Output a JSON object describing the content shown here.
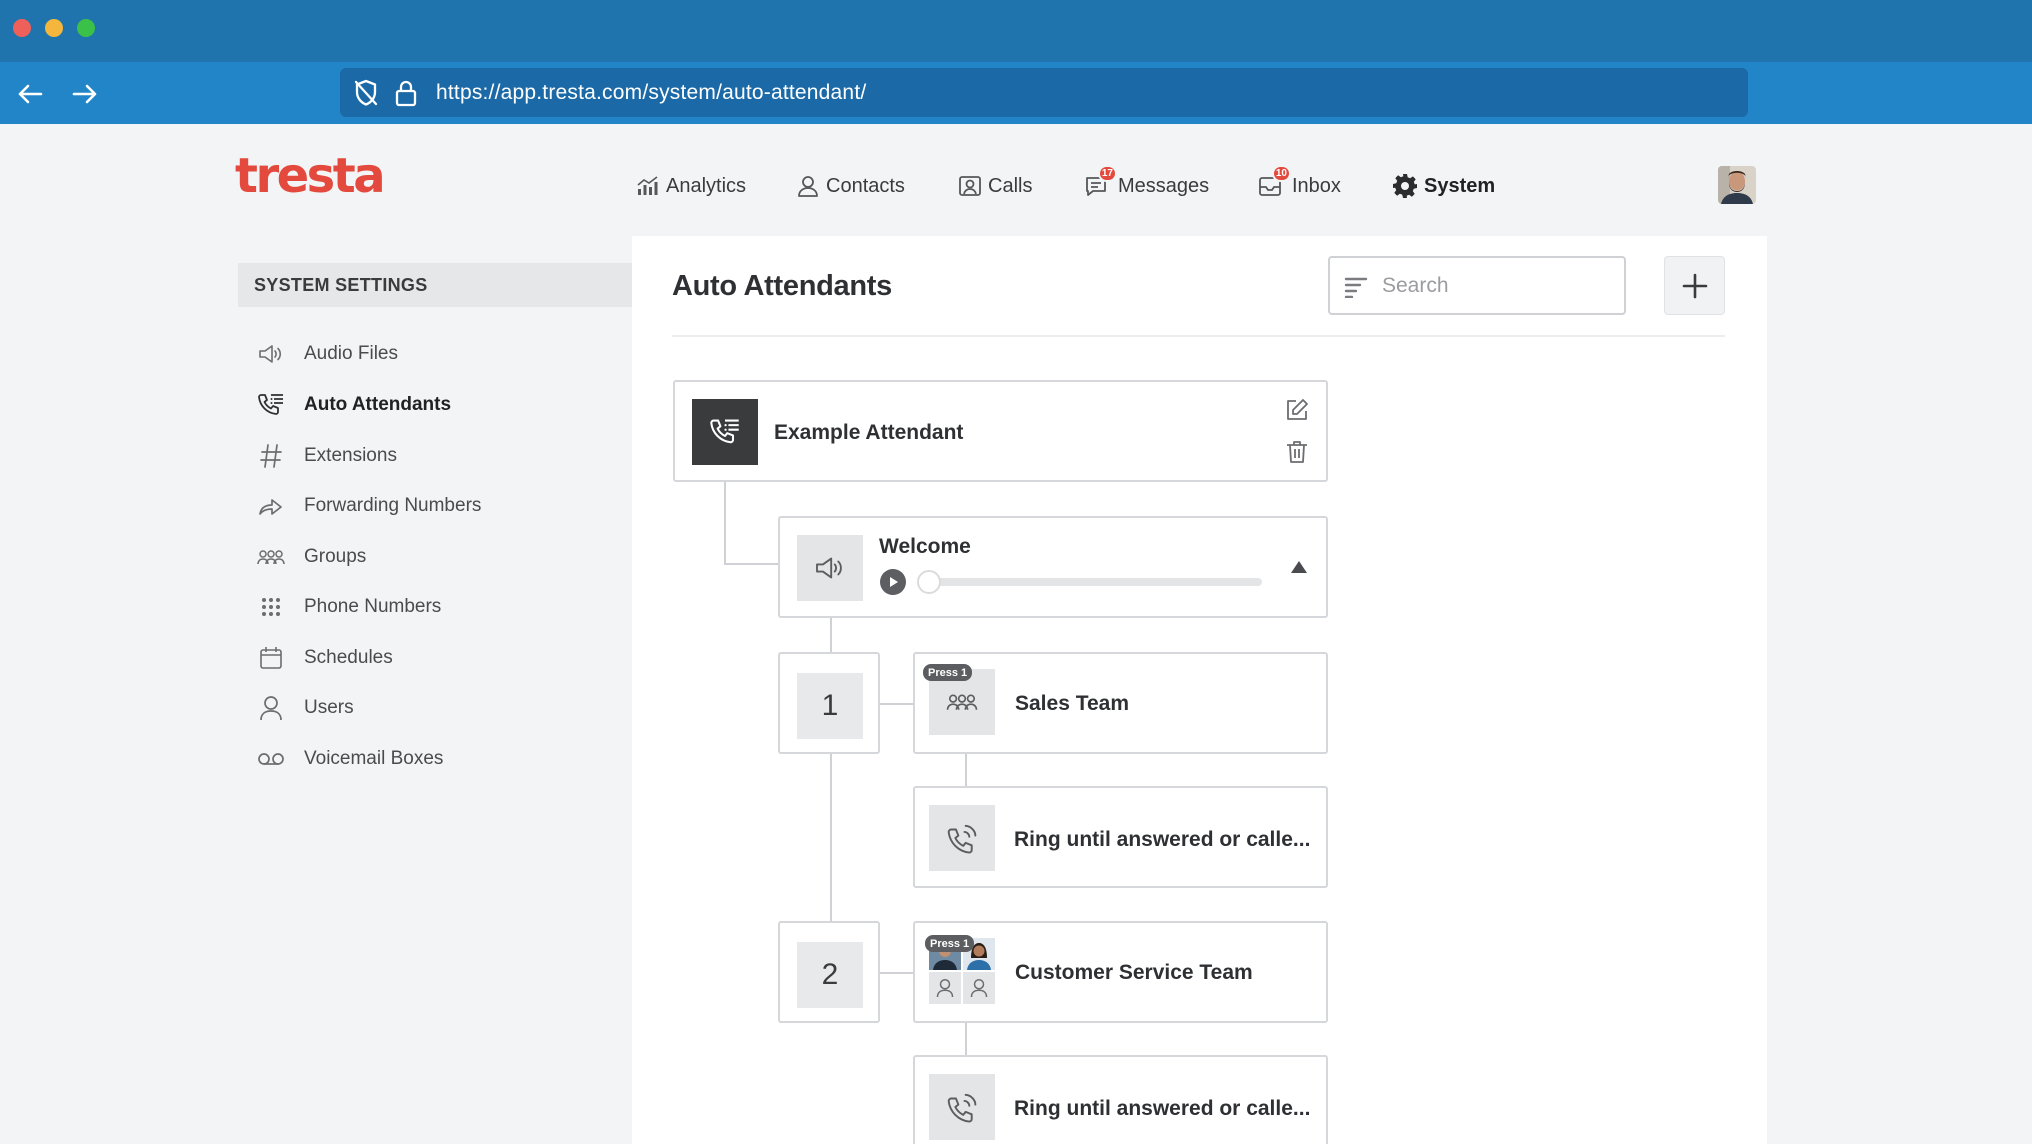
{
  "browser": {
    "url": "https://app.tresta.com/system/auto-attendant/"
  },
  "app": {
    "logo": "tresta",
    "nav": [
      {
        "label": "Analytics",
        "icon": "analytics-icon"
      },
      {
        "label": "Contacts",
        "icon": "contact-icon"
      },
      {
        "label": "Calls",
        "icon": "calls-icon"
      },
      {
        "label": "Messages",
        "icon": "messages-icon",
        "badge": "17"
      },
      {
        "label": "Inbox",
        "icon": "inbox-icon",
        "badge": "10"
      },
      {
        "label": "System",
        "icon": "gear-icon",
        "active": true
      }
    ]
  },
  "sidebar": {
    "header": "SYSTEM SETTINGS",
    "items": [
      {
        "label": "Audio Files",
        "icon": "speaker-icon"
      },
      {
        "label": "Auto Attendants",
        "icon": "phone-menu-icon",
        "active": true
      },
      {
        "label": "Extensions",
        "icon": "hash-icon"
      },
      {
        "label": "Forwarding Numbers",
        "icon": "forward-arrow-icon"
      },
      {
        "label": "Groups",
        "icon": "group-icon"
      },
      {
        "label": "Phone Numbers",
        "icon": "dialpad-icon"
      },
      {
        "label": "Schedules",
        "icon": "calendar-icon"
      },
      {
        "label": "Users",
        "icon": "user-icon"
      },
      {
        "label": "Voicemail Boxes",
        "icon": "voicemail-icon"
      }
    ]
  },
  "main": {
    "title": "Auto Attendants",
    "search_placeholder": "Search",
    "attendant": {
      "name": "Example Attendant"
    },
    "greeting": {
      "label": "Welcome",
      "progress": 0
    },
    "options": [
      {
        "key": "1",
        "press_tag": "Press 1",
        "target": "Sales Team",
        "ring_rule": "Ring until answered or calle..."
      },
      {
        "key": "2",
        "press_tag": "Press 1",
        "target": "Customer Service Team",
        "ring_rule": "Ring until answered or calle..."
      }
    ]
  },
  "colors": {
    "titlebar": "#1f74ad",
    "navbar": "#2285c8",
    "brand": "#e3493c",
    "badge": "#e3493c"
  }
}
